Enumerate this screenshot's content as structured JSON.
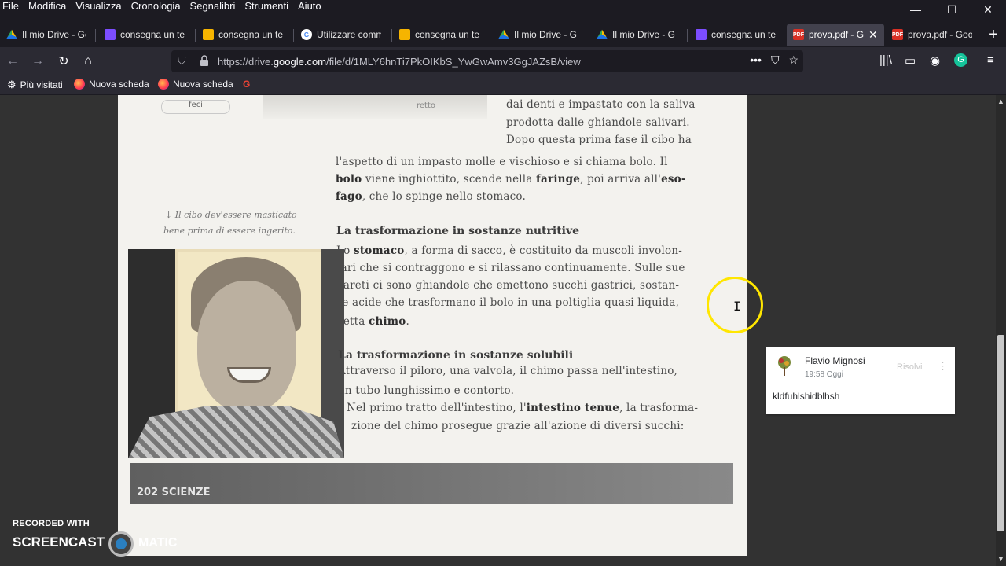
{
  "menu": [
    "File",
    "Modifica",
    "Visualizza",
    "Cronologia",
    "Segnalibri",
    "Strumenti",
    "Aiuto"
  ],
  "window_controls": {
    "minimize": "—",
    "maximize": "☐",
    "close": "✕"
  },
  "tabs": [
    {
      "label": "Il mio Drive - Go",
      "icon": "drive-icon"
    },
    {
      "label": "consegna un te",
      "icon": "classroom-icon"
    },
    {
      "label": "consegna un te",
      "icon": "assignment-icon"
    },
    {
      "label": "Utilizzare comm",
      "icon": "google-icon"
    },
    {
      "label": "consegna un te",
      "icon": "assignment-icon"
    },
    {
      "label": "Il mio Drive - G",
      "icon": "drive-icon"
    },
    {
      "label": "Il mio Drive - G",
      "icon": "drive-icon"
    },
    {
      "label": "consegna un te",
      "icon": "classroom-icon"
    },
    {
      "label": "prova.pdf - G",
      "icon": "pdf-icon",
      "active": true
    },
    {
      "label": "prova.pdf - Goo",
      "icon": "pdf-icon"
    }
  ],
  "url": {
    "pre": "https://drive.",
    "domain": "google.com",
    "post": "/file/d/1MLY6hnTi7PkOIKbS_YwGwAmv3GgJAZsB/view"
  },
  "bookmarks": [
    {
      "label": "Più visitati",
      "icon": "gear-icon"
    },
    {
      "label": "Nuova scheda",
      "icon": "firefox-icon"
    },
    {
      "label": "Nuova scheda",
      "icon": "firefox-icon"
    },
    {
      "label": "",
      "icon": "google-icon"
    }
  ],
  "pdf": {
    "top_label_left": "feci",
    "top_label_right": "retto",
    "para1": [
      "dai denti e impastato con la saliva",
      "prodotta dalle ghiandole salivari.",
      "Dopo questa prima fase il cibo ha"
    ],
    "para1b": [
      "l'aspetto di un impasto molle e vischioso e si chiama bolo. Il"
    ],
    "para1c": {
      "w1": "bolo",
      "t1": " viene inghiottito, scende nella ",
      "w2": "faringe",
      "t2": ", poi arriva all'",
      "w3": "eso-"
    },
    "para1d": {
      "w1": "fago",
      "t1": ", che lo spinge nello stomaco."
    },
    "caption": [
      "↓ Il cibo dev'essere masticato",
      "bene prima di essere ingerito."
    ],
    "heading1": "La trasformazione in sostanze nutritive",
    "para2a": {
      "t0": "Lo ",
      "w1": "stomaco",
      "t1": ", a forma di sacco, è costituito da muscoli involon-"
    },
    "para2": [
      "tari che si contraggono e si rilassano continuamente. Sulle sue",
      "pareti ci sono ghiandole che emettono succhi gastrici, sostan-",
      "ze acide che trasformano il bolo in una poltiglia quasi liquida,"
    ],
    "para2e": {
      "t0": "detta ",
      "w1": "chimo",
      "t1": "."
    },
    "heading2": "La trasformazione in sostanze solubili",
    "para3": [
      "Attraverso il piloro, una valvola, il chimo passa nell'intestino,",
      "un tubo lunghissimo e contorto."
    ],
    "para3c": {
      "t0": "Nel primo tratto dell'intestino, l'",
      "w1": "intestino tenue",
      "t1": ", la trasforma-"
    },
    "para3d": "zione del chimo prosegue grazie all'azione di diversi succhi:",
    "page_label": "202 SCIENZE"
  },
  "comment": {
    "author": "Flavio Mignosi",
    "time": "19:58 Oggi",
    "resolve": "Risolvi",
    "text": "kldfuhlshidblhsh"
  },
  "watermark": {
    "recorded": "RECORDED WITH",
    "brand1": "SCREENCAST",
    "brand2": "MATIC"
  }
}
